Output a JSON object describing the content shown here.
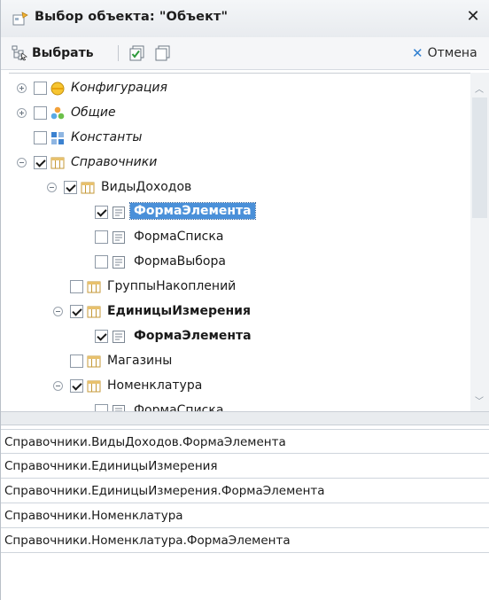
{
  "window": {
    "title": "Выбор объекта: \"Объект\""
  },
  "toolbar": {
    "select_label": "Выбрать",
    "cancel_label": "Отмена"
  },
  "tree": {
    "items": [
      {
        "label": "Конфигурация",
        "icon": "configuration-icon",
        "italic": true,
        "checked": false,
        "expander": "plus"
      },
      {
        "label": "Общие",
        "icon": "common-icon",
        "italic": true,
        "checked": false,
        "expander": "plus"
      },
      {
        "label": "Константы",
        "icon": "constants-icon",
        "italic": true,
        "checked": false,
        "expander": "none"
      },
      {
        "label": "Справочники",
        "icon": "catalog-icon",
        "italic": true,
        "checked": true,
        "expander": "minus"
      },
      {
        "label": "ВидыДоходов",
        "icon": "catalog-icon",
        "checked": true,
        "expander": "minus"
      },
      {
        "label": "ФормаЭлемента",
        "icon": "form-icon",
        "checked": true,
        "selected": true
      },
      {
        "label": "ФормаСписка",
        "icon": "form-icon",
        "checked": false
      },
      {
        "label": "ФормаВыбора",
        "icon": "form-icon",
        "checked": false
      },
      {
        "label": "ГруппыНакоплений",
        "icon": "catalog-icon",
        "checked": false
      },
      {
        "label": "ЕдиницыИзмерения",
        "icon": "catalog-icon",
        "checked": true,
        "bold": true,
        "expander": "minus"
      },
      {
        "label": "ФормаЭлемента",
        "icon": "form-icon",
        "checked": true,
        "bold": true
      },
      {
        "label": "Магазины",
        "icon": "catalog-icon",
        "checked": false
      },
      {
        "label": "Номенклатура",
        "icon": "catalog-icon",
        "checked": true,
        "expander": "minus"
      },
      {
        "label": "ФормаСписка",
        "icon": "form-icon",
        "checked": false
      }
    ]
  },
  "selected_list": {
    "items": [
      "Справочники.ВидыДоходов.ФормаЭлемента",
      "Справочники.ЕдиницыИзмерения",
      "Справочники.ЕдиницыИзмерения.ФормаЭлемента",
      "Справочники.Номенклатура",
      "Справочники.Номенклатура.ФормаЭлемента"
    ]
  },
  "colors": {
    "selection": "#4a90d9",
    "cancel_accent": "#2f7fd0"
  }
}
